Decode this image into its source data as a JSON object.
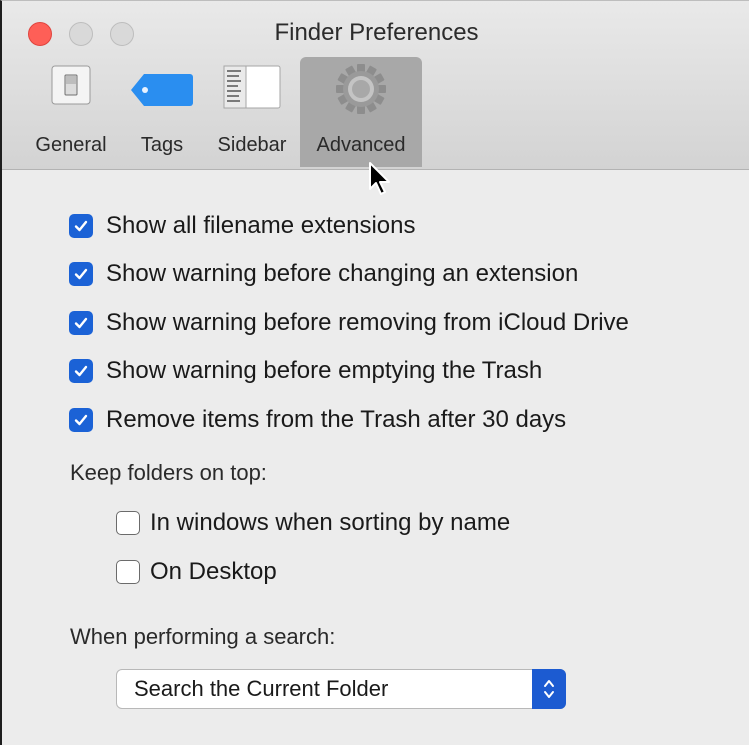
{
  "window": {
    "title": "Finder Preferences"
  },
  "tabs": [
    {
      "label": "General",
      "icon": "switch-icon"
    },
    {
      "label": "Tags",
      "icon": "tag-icon"
    },
    {
      "label": "Sidebar",
      "icon": "sidebar-icon"
    },
    {
      "label": "Advanced",
      "icon": "gear-icon",
      "selected": true
    }
  ],
  "options": [
    {
      "label": "Show all filename extensions",
      "checked": true
    },
    {
      "label": "Show warning before changing an extension",
      "checked": true
    },
    {
      "label": "Show warning before removing from iCloud Drive",
      "checked": true
    },
    {
      "label": "Show warning before emptying the Trash",
      "checked": true
    },
    {
      "label": "Remove items from the Trash after 30 days",
      "checked": true
    }
  ],
  "keep_folders": {
    "heading": "Keep folders on top:",
    "items": [
      {
        "label": "In windows when sorting by name",
        "checked": false
      },
      {
        "label": "On Desktop",
        "checked": false
      }
    ]
  },
  "search": {
    "heading": "When performing a search:",
    "selected": "Search the Current Folder"
  },
  "colors": {
    "accent": "#1b62d6",
    "close": "#fe5f57",
    "tag_blue": "#2a8ef0"
  }
}
